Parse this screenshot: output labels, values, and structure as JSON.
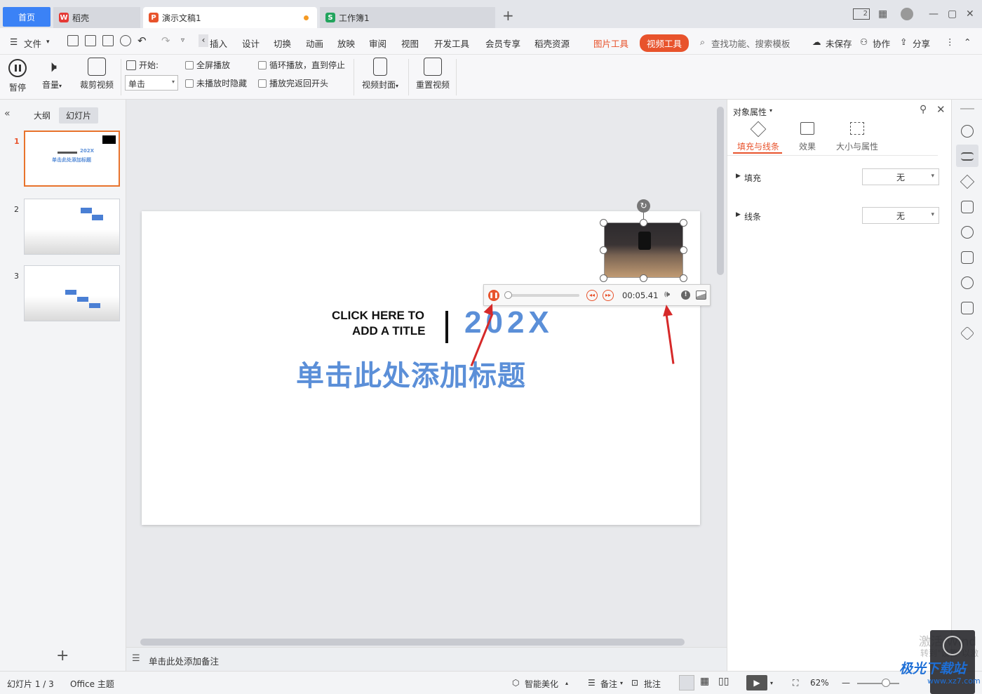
{
  "tabs": {
    "home": "首页",
    "daoke": "稻壳",
    "ppt": "演示文稿1",
    "et": "工作簿1",
    "add": "+"
  },
  "window_controls": [
    "2",
    "▦",
    "—",
    "▢",
    "✕"
  ],
  "menu": {
    "file": "文件",
    "items": [
      "插入",
      "设计",
      "切换",
      "动画",
      "放映",
      "审阅",
      "视图",
      "开发工具",
      "会员专享",
      "稻壳资源"
    ],
    "picture_tools": "图片工具",
    "video_tools": "视频工具",
    "search_placeholder": "查找功能、搜索模板",
    "unsaved": "未保存",
    "collab": "协作",
    "share": "分享"
  },
  "ribbon": {
    "pause": "暂停",
    "volume": "音量",
    "trim": "裁剪视频",
    "start_label": "开始:",
    "start_value": "单击",
    "fullscreen": "全屏播放",
    "hide_not_playing": "未播放时隐藏",
    "loop": "循环播放，直到停止",
    "rewind": "播放完返回开头",
    "cover": "视频封面",
    "reset": "重置视频"
  },
  "left_panel": {
    "outline_tab": "大纲",
    "slides_tab": "幻灯片",
    "slide_numbers": [
      "1",
      "2",
      "3"
    ],
    "thumb1_year": "202X",
    "thumb1_title": "单击此处添加标题",
    "add": "+"
  },
  "slide": {
    "click_here_line1": "CLICK HERE TO",
    "click_here_line2": "ADD A TITLE",
    "year": "202X",
    "title_cn": "单击此处添加标题"
  },
  "video_player": {
    "time": "00:05.41",
    "progress": 0.0
  },
  "notes_placeholder": "单击此处添加备注",
  "right_panel": {
    "title": "对象属性",
    "tabs": [
      "填充与线条",
      "效果",
      "大小与属性"
    ],
    "fill_label": "填充",
    "fill_value": "无",
    "line_label": "线条",
    "line_value": "无"
  },
  "status": {
    "slide_counter": "幻灯片 1 / 3",
    "theme": "Office 主题",
    "smart": "智能美化",
    "notes": "备注",
    "comment": "批注",
    "zoom": "62%"
  },
  "watermark": {
    "activate1": "激活 Wind",
    "activate2": "转到\"设置\"以激",
    "site": "极光下载站",
    "site_url": "www.xz7.com"
  },
  "colors": {
    "accent_blue": "#3b82f6",
    "accent_orange": "#e8532c",
    "title_blue": "#5b8fd8",
    "arrow_red": "#d62929"
  }
}
